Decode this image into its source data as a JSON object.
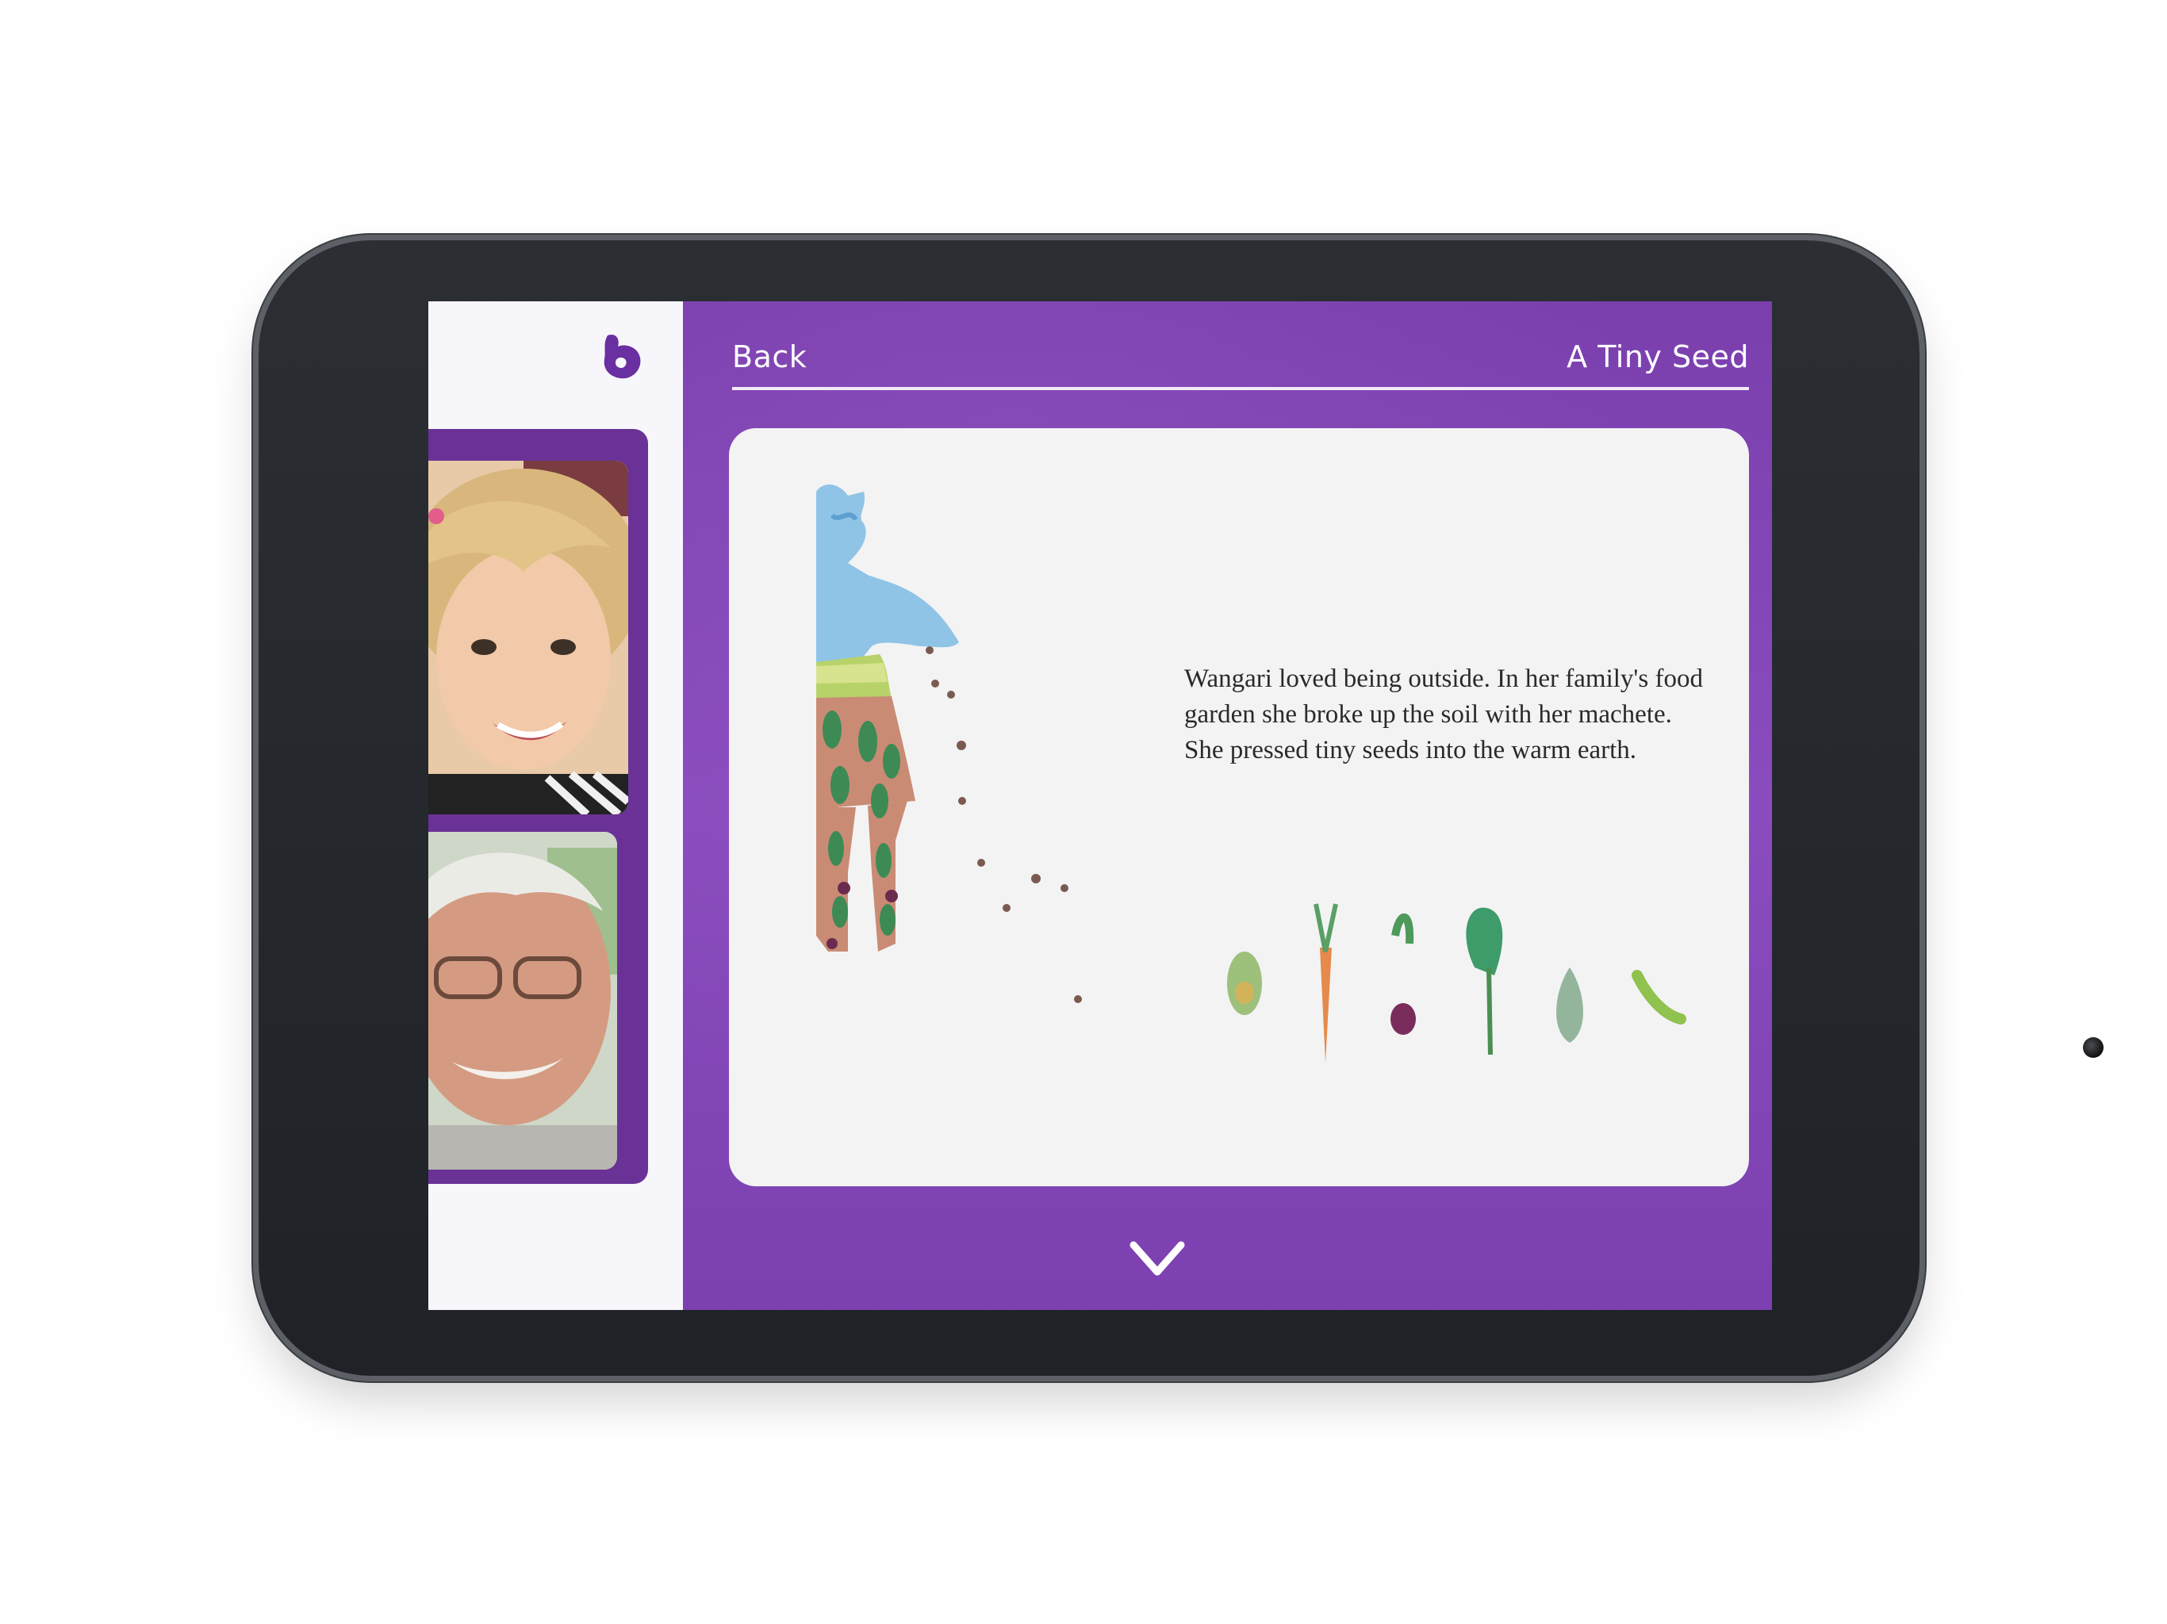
{
  "app": {
    "accent_color": "#7b3fae",
    "sidebar_color": "#f7f6fa",
    "logo_icon": "heart-b-logo-icon"
  },
  "header": {
    "back_label": "Back",
    "book_title": "A Tiny Seed"
  },
  "page": {
    "story_text": "Wangari loved being outside. In her family's food garden she broke up the soil with her machete. She pressed tiny seeds into the warm earth.",
    "illustration": "girl-sowing-seeds-illustration"
  },
  "video_call": {
    "participants": [
      "child-video-feed",
      "grandfather-video-feed"
    ]
  },
  "navigation": {
    "next_icon": "chevron-down-icon"
  }
}
